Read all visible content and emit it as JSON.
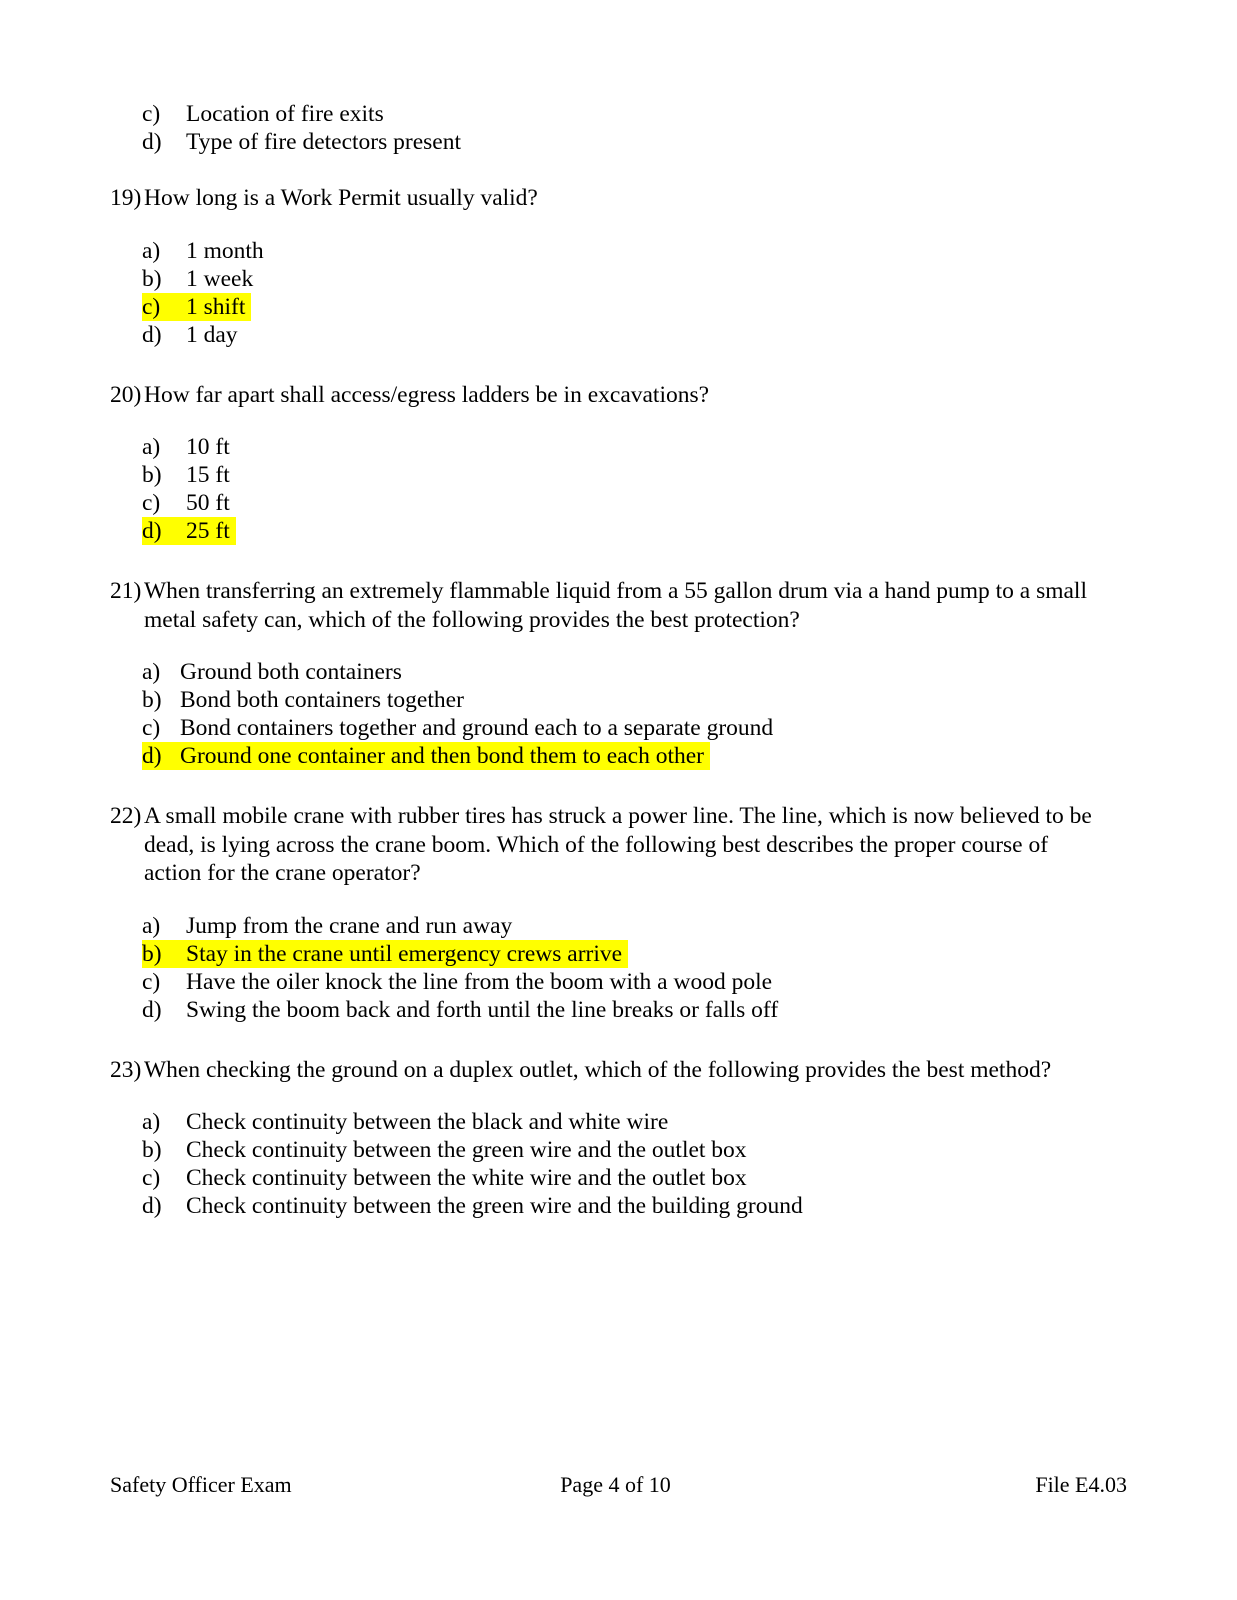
{
  "document": {
    "title": "Safety Officer Exam",
    "highlight_color": "#ffff00"
  },
  "continued_options": [
    {
      "mark": "c)",
      "text": "Location of fire exits",
      "highlighted": false
    },
    {
      "mark": "d)",
      "text": "Type of fire detectors present",
      "highlighted": false
    }
  ],
  "questions": [
    {
      "number": "19)",
      "text": "How long is a Work Permit usually valid?",
      "options": [
        {
          "mark": "a)",
          "text": "1 month",
          "highlighted": false
        },
        {
          "mark": "b)",
          "text": "1 week",
          "highlighted": false
        },
        {
          "mark": "c)",
          "text": "1 shift",
          "highlighted": true
        },
        {
          "mark": "d)",
          "text": "1 day",
          "highlighted": false
        }
      ]
    },
    {
      "number": "20)",
      "text": "How far apart shall access/egress ladders be in excavations?",
      "options": [
        {
          "mark": "a)",
          "text": "10 ft",
          "highlighted": false
        },
        {
          "mark": "b)",
          "text": "15 ft",
          "highlighted": false
        },
        {
          "mark": "c)",
          "text": "50 ft",
          "highlighted": false
        },
        {
          "mark": "d)",
          "text": "25 ft",
          "highlighted": true
        }
      ]
    },
    {
      "number": "21)",
      "text": "When transferring an extremely flammable liquid from a 55 gallon drum via a hand pump to a small metal safety can, which of the following provides the best protection?",
      "options": [
        {
          "mark": "a)",
          "text": "Ground both containers",
          "highlighted": false
        },
        {
          "mark": "b)",
          "text": "Bond both containers together",
          "highlighted": false
        },
        {
          "mark": "c)",
          "text": "Bond containers together and ground each to a separate ground",
          "highlighted": false
        },
        {
          "mark": "d)",
          "text": "Ground one container and then bond them to each other",
          "highlighted": true
        }
      ]
    },
    {
      "number": "22)",
      "text": "A small mobile crane with rubber tires has struck a power line.  The line, which is now believed to be dead, is lying across the crane boom.  Which of the following best describes the proper course of action for the crane operator?",
      "options": [
        {
          "mark": "a)",
          "text": "Jump from the crane and run away",
          "highlighted": false
        },
        {
          "mark": "b)",
          "text": "Stay in the crane until emergency crews arrive",
          "highlighted": true
        },
        {
          "mark": "c)",
          "text": "Have the oiler knock the line from the boom with a wood pole",
          "highlighted": false
        },
        {
          "mark": "d)",
          "text": "Swing the boom back and forth until the line breaks or falls off",
          "highlighted": false
        }
      ]
    },
    {
      "number": "23)",
      "text": "When checking the ground on a duplex outlet, which of the following provides the best method?",
      "options": [
        {
          "mark": "a)",
          "text": "Check continuity between the black and white wire",
          "highlighted": false
        },
        {
          "mark": "b)",
          "text": "Check continuity between the green wire and the outlet box",
          "highlighted": false
        },
        {
          "mark": "c)",
          "text": "Check continuity between the white wire and the outlet box",
          "highlighted": false
        },
        {
          "mark": "d)",
          "text": "Check continuity between the green wire and the building ground",
          "highlighted": false
        }
      ]
    }
  ],
  "footer": {
    "left": "Safety Officer Exam",
    "center": "Page 4 of 10",
    "right": "File E4.03"
  }
}
